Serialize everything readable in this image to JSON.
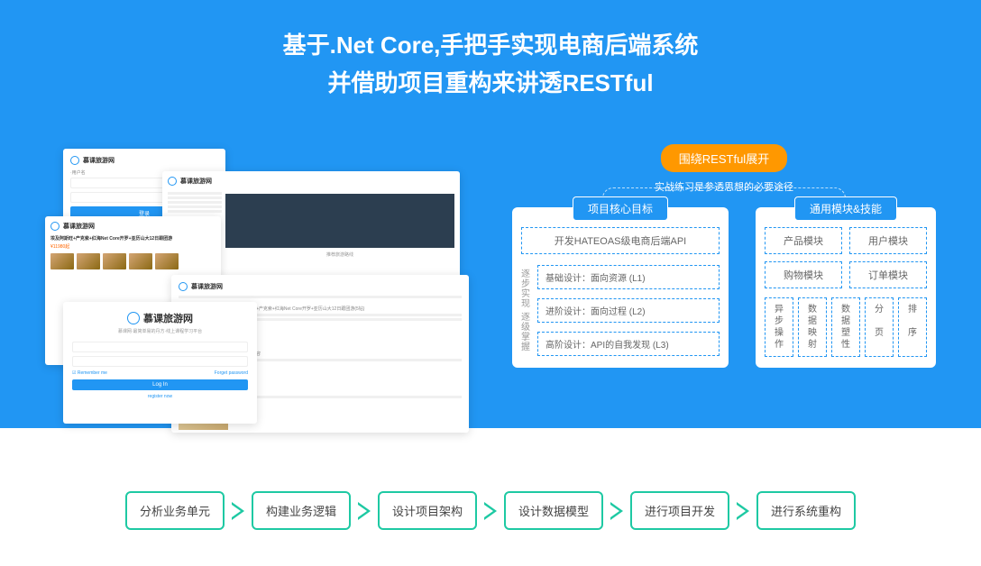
{
  "hero": {
    "title_line1": "基于.Net Core,手把手实现电商后端系统",
    "title_line2": "并借助项目重构来讲透RESTful"
  },
  "screenshots": {
    "brand": "慕课旅游网",
    "login_subtitle": "慕课网·最简单易的丹方·线上课程学习平台",
    "remember": "Remember me",
    "forgot": "Forget password",
    "register": "register now",
    "price": "¥11980起"
  },
  "restful_badge": "围绕RESTful展开",
  "restful_note": "实战练习是参透思想的必要途径",
  "left_panel": {
    "title": "项目核心目标",
    "api": "开发HATEOAS级电商后端API",
    "vlabel": "逐步实现 逐级掌握",
    "levels": [
      "基础设计：面向资源 (L1)",
      "进阶设计：面向过程 (L2)",
      "高阶设计：API的自我发现 (L3)"
    ]
  },
  "right_panel": {
    "title": "通用模块&技能",
    "modules": [
      "产品模块",
      "用户模块",
      "购物模块",
      "订单模块"
    ],
    "skills": [
      "异步操作",
      "数据映射",
      "数据塑性",
      "分页",
      "排序"
    ]
  },
  "flow_steps": [
    "分析业务单元",
    "构建业务逻辑",
    "设计项目架构",
    "设计数据模型",
    "进行项目开发",
    "进行系统重构"
  ]
}
